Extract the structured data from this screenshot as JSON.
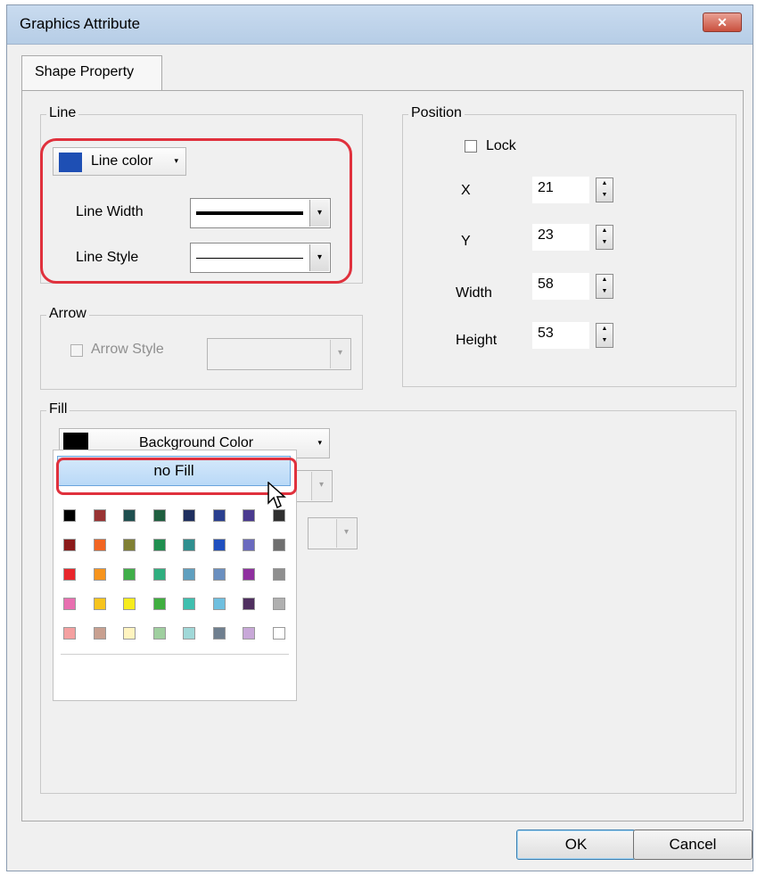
{
  "window": {
    "title": "Graphics Attribute",
    "close_glyph": "✕"
  },
  "tabs": [
    {
      "label": "Shape Property"
    }
  ],
  "line_group": {
    "label": "Line",
    "color_button": {
      "label": "Line color",
      "swatch_color": "#1e4fb4",
      "arrow": "▾"
    },
    "width": {
      "label": "Line Width",
      "arrow": "▾"
    },
    "style": {
      "label": "Line Style",
      "arrow": "▾"
    }
  },
  "arrow_group": {
    "label": "Arrow",
    "style_checkbox_label": "Arrow Style",
    "checked": false,
    "arrow": "▾"
  },
  "position_group": {
    "label": "Position",
    "lock": {
      "label": "Lock",
      "checked": false
    },
    "fields": [
      {
        "label": "X",
        "value": "21"
      },
      {
        "label": "Y",
        "value": "23"
      },
      {
        "label": "Width",
        "value": "58"
      },
      {
        "label": "Height",
        "value": "53"
      }
    ]
  },
  "fill_group": {
    "label": "Fill",
    "background_color": {
      "label": "Background Color",
      "swatch_color": "#000000",
      "arrow": "▾"
    },
    "dropdown_arrows": [
      "▾",
      "▾"
    ]
  },
  "color_popup": {
    "no_fill_label": "no Fill",
    "rows": [
      [
        "#000000",
        "#993333",
        "#1f4f4f",
        "#1f5f3f",
        "#1f2f5f",
        "#2a3f8f",
        "#4a3a8f",
        "#2f2f2f"
      ],
      [
        "#8b1a1a",
        "#f26522",
        "#808033",
        "#1f8f4f",
        "#2f8f8f",
        "#1f4fbf",
        "#6a6abf",
        "#6f6f6f"
      ],
      [
        "#e8262b",
        "#f7941d",
        "#3fae49",
        "#2fae7f",
        "#5f9fbf",
        "#6a8fbf",
        "#8f2f9f",
        "#8f8f8f"
      ],
      [
        "#e86fb0",
        "#f7c41d",
        "#f7ec1d",
        "#3fae3f",
        "#3fbfaf",
        "#6fbfdf",
        "#4f2f5f",
        "#b0b0b0"
      ],
      [
        "#f4a0a0",
        "#c8a090",
        "#fff4c0",
        "#9fcf9f",
        "#a0d8d8",
        "#6f7f8f",
        "#c8a8d8",
        "#ffffff"
      ]
    ]
  },
  "buttons": {
    "ok": "OK",
    "cancel": "Cancel"
  },
  "icons": {
    "spin_up": "▲",
    "spin_down": "▼"
  },
  "colors": {
    "highlight": "#e0313d",
    "selection": "#b9d9f7"
  }
}
